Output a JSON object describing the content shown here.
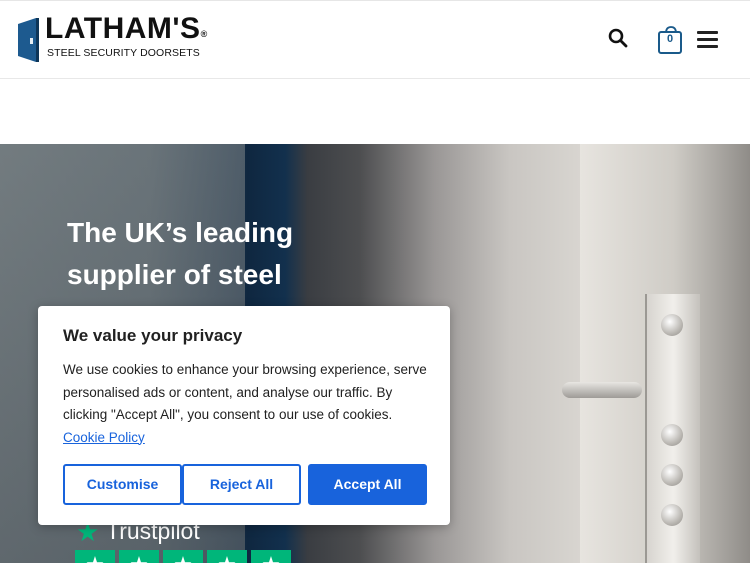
{
  "header": {
    "logo_title": "LATHAM'S",
    "logo_reg": "®",
    "logo_subtitle": "STEEL SECURITY DOORSETS",
    "cart_count": "0"
  },
  "hero": {
    "title": "The UK’s leading supplier of steel",
    "trustpilot_label": "Trustpilot",
    "trustpilot_rating_stars": 5
  },
  "cookie_banner": {
    "title": "We value your privacy",
    "body": "We use cookies to enhance your browsing experience, serve personalised ads or content, and analyse our traffic. By clicking \"Accept All\", you consent to our use of cookies. ",
    "policy_link": "Cookie Policy",
    "customise_label": "Customise",
    "reject_label": "Reject All",
    "accept_label": "Accept All"
  },
  "colors": {
    "accent": "#1863dc",
    "trustpilot_green": "#00b67a",
    "cart_number": "#1a5a8a"
  },
  "icons": {
    "search": "search-icon",
    "cart": "cart-icon",
    "menu": "hamburger-menu-icon",
    "logo": "door-logo-icon"
  }
}
